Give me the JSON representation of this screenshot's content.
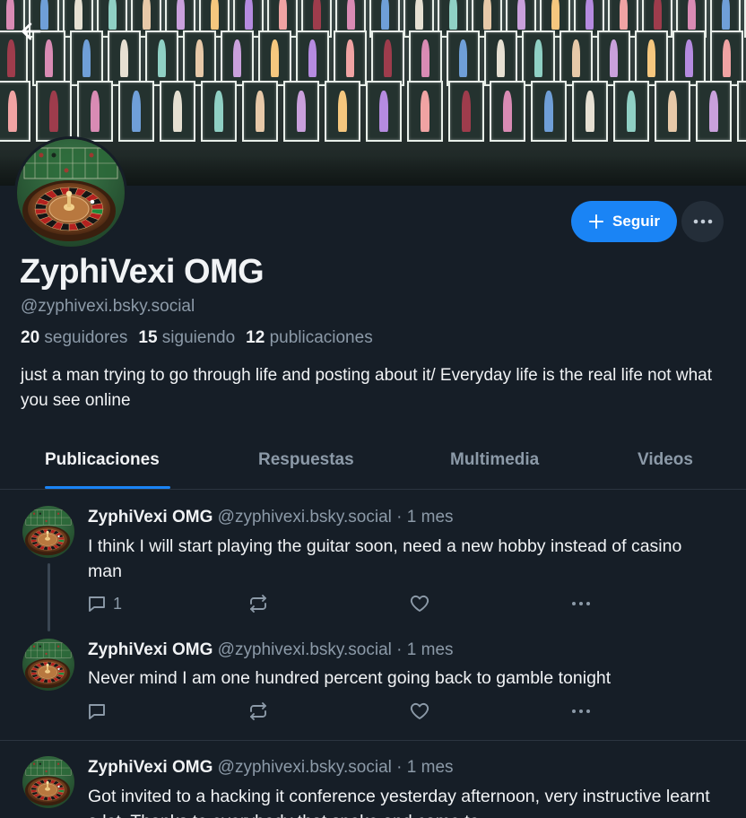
{
  "profile": {
    "display_name": "ZyphiVexi OMG",
    "handle": "@zyphivexi.bsky.social",
    "followers_count": "20",
    "followers_label": "seguidores",
    "following_count": "15",
    "following_label": "siguiendo",
    "posts_count": "12",
    "posts_label": "publicaciones",
    "bio": "just a man trying to go through life and posting about it/ Everyday life is the real life not what you see online",
    "follow_label": "Seguir"
  },
  "tabs": [
    {
      "label": "Publicaciones",
      "active": true
    },
    {
      "label": "Respuestas",
      "active": false
    },
    {
      "label": "Multimedia",
      "active": false
    },
    {
      "label": "Videos",
      "active": false
    }
  ],
  "posts": [
    {
      "author": "ZyphiVexi OMG",
      "handle": "@zyphivexi.bsky.social",
      "time": "· 1 mes",
      "text": "I think I will start playing the guitar soon, need a new hobby instead of casino man",
      "reply_count": "1"
    },
    {
      "author": "ZyphiVexi OMG",
      "handle": "@zyphivexi.bsky.social",
      "time": "· 1 mes",
      "text": "Never mind I am one hundred percent going back to gamble tonight",
      "reply_count": ""
    },
    {
      "author": "ZyphiVexi OMG",
      "handle": "@zyphivexi.bsky.social",
      "time": "· 1 mes",
      "text": "Got invited to a hacking it conference yesterday afternoon, very instructive learnt a lot. Thanks to everybody that spoke and came to",
      "reply_count": ""
    }
  ],
  "colors": {
    "background": "#161e27",
    "accent": "#1a84f5",
    "muted_text": "#8c9aa8",
    "divider": "#2b3540"
  },
  "icons": {
    "back": "arrow-left-icon",
    "more": "ellipsis-icon",
    "reply": "speech-bubble-icon",
    "repost": "repost-arrows-icon",
    "like": "heart-icon"
  }
}
